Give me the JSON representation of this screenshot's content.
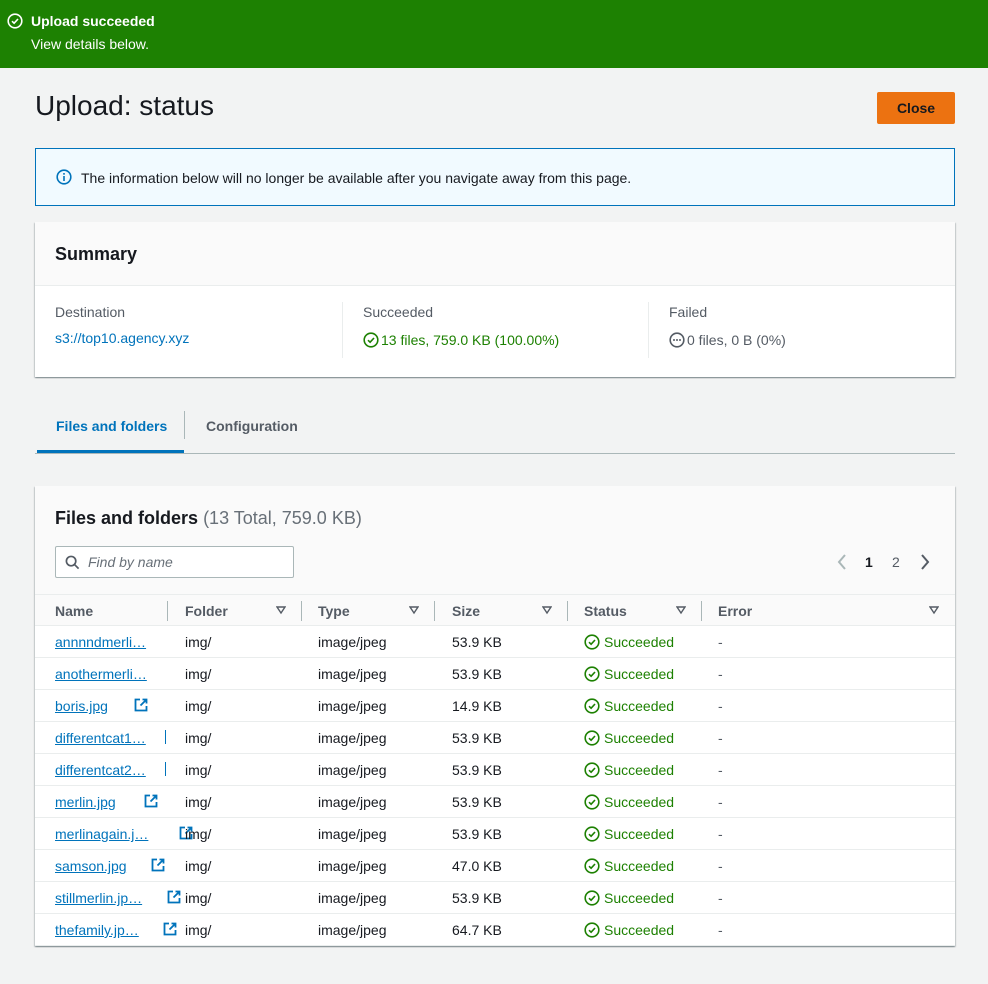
{
  "flash": {
    "title": "Upload succeeded",
    "subtitle": "View details below.",
    "color": "#1d8102"
  },
  "header": {
    "title": "Upload: status",
    "close_label": "Close",
    "close_color": "#ec7211"
  },
  "alert": {
    "text": "The information below will no longer be available after you navigate away from this page.",
    "icon": "info-icon"
  },
  "summary": {
    "title": "Summary",
    "destination_label": "Destination",
    "destination_value": "s3://top10.agency.xyz",
    "succeeded_label": "Succeeded",
    "succeeded_value": "13 files, 759.0 KB (100.00%)",
    "failed_label": "Failed",
    "failed_value": "0 files, 0 B (0%)"
  },
  "tabs": [
    {
      "label": "Files and folders",
      "active": true
    },
    {
      "label": "Configuration",
      "active": false
    }
  ],
  "files": {
    "title": "Files and folders",
    "count": "(13 Total, 759.0 KB)",
    "search_placeholder": "Find by name",
    "pagination": {
      "pages": [
        "1",
        "2"
      ],
      "current": "1"
    },
    "columns": [
      "Name",
      "Folder",
      "Type",
      "Size",
      "Status",
      "Error"
    ],
    "rows": [
      {
        "name": "annnndmerli…",
        "folder": "img/",
        "type": "image/jpeg",
        "size": "53.9 KB",
        "status": "Succeeded",
        "error": "-"
      },
      {
        "name": "anothermerli…",
        "folder": "img/",
        "type": "image/jpeg",
        "size": "53.9 KB",
        "status": "Succeeded",
        "error": "-"
      },
      {
        "name": "boris.jpg",
        "folder": "img/",
        "type": "image/jpeg",
        "size": "14.9 KB",
        "status": "Succeeded",
        "error": "-"
      },
      {
        "name": "differentcat1…",
        "folder": "img/",
        "type": "image/jpeg",
        "size": "53.9 KB",
        "status": "Succeeded",
        "error": "-"
      },
      {
        "name": "differentcat2…",
        "folder": "img/",
        "type": "image/jpeg",
        "size": "53.9 KB",
        "status": "Succeeded",
        "error": "-"
      },
      {
        "name": "merlin.jpg",
        "folder": "img/",
        "type": "image/jpeg",
        "size": "53.9 KB",
        "status": "Succeeded",
        "error": "-"
      },
      {
        "name": "merlinagain.j…",
        "folder": "img/",
        "type": "image/jpeg",
        "size": "53.9 KB",
        "status": "Succeeded",
        "error": "-"
      },
      {
        "name": "samson.jpg",
        "folder": "img/",
        "type": "image/jpeg",
        "size": "47.0 KB",
        "status": "Succeeded",
        "error": "-"
      },
      {
        "name": "stillmerlin.jp…",
        "folder": "img/",
        "type": "image/jpeg",
        "size": "53.9 KB",
        "status": "Succeeded",
        "error": "-"
      },
      {
        "name": "thefamily.jp…",
        "folder": "img/",
        "type": "image/jpeg",
        "size": "64.7 KB",
        "status": "Succeeded",
        "error": "-"
      }
    ]
  }
}
